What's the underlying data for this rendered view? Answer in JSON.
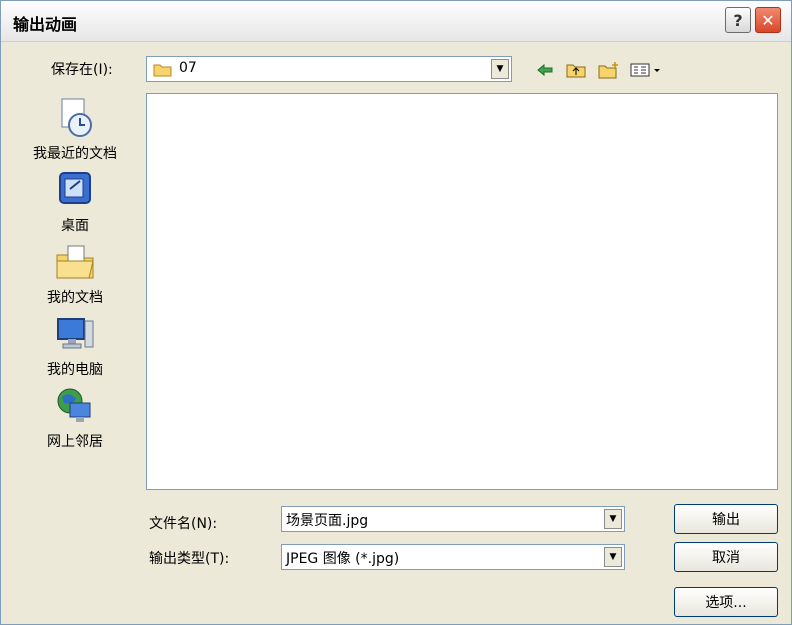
{
  "window": {
    "title": "输出动画",
    "help_label": "?",
    "close_label": "✕"
  },
  "lookin": {
    "label": "保存在(I):",
    "value": "07",
    "folder_icon": "folder-icon"
  },
  "toolbar": {
    "icons": [
      "back-arrow-icon",
      "up-folder-icon",
      "new-folder-icon",
      "view-menu-icon"
    ]
  },
  "places": [
    {
      "label": "我最近的文档",
      "icon": "recent-documents-icon"
    },
    {
      "label": "桌面",
      "icon": "desktop-icon"
    },
    {
      "label": "我的文档",
      "icon": "my-documents-icon"
    },
    {
      "label": "我的电脑",
      "icon": "my-computer-icon"
    },
    {
      "label": "网上邻居",
      "icon": "network-places-icon"
    }
  ],
  "filename": {
    "label": "文件名(N):",
    "value": "场景页面.jpg"
  },
  "filetype": {
    "label": "输出类型(T):",
    "value": "JPEG 图像 (*.jpg)"
  },
  "buttons": {
    "export": "输出",
    "cancel": "取消",
    "options": "选项..."
  },
  "colors": {
    "accent_border": "#003c74",
    "close_red": "#d9472a",
    "folder_yellow": "#f6d46b"
  }
}
